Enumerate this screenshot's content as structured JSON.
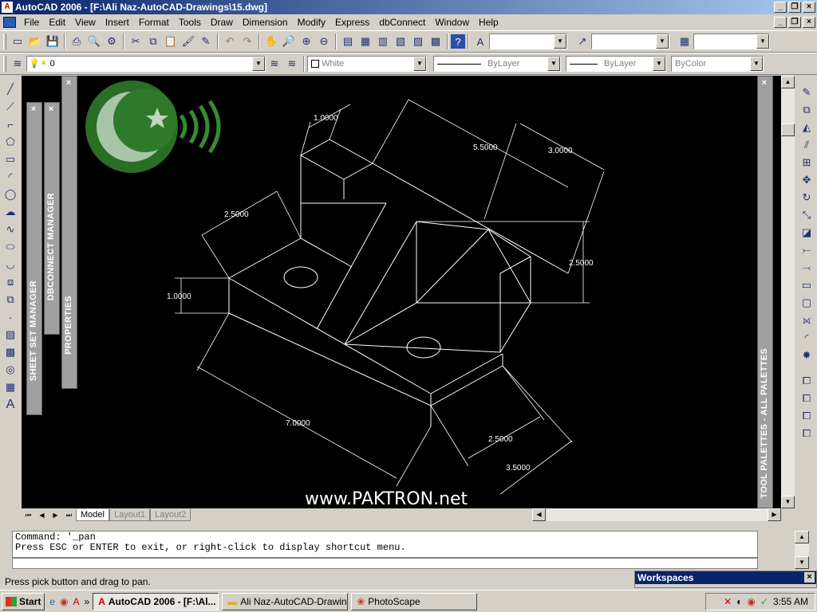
{
  "window": {
    "title": "AutoCAD 2006 - [F:\\Ali Naz-AutoCAD-Drawings\\15.dwg]",
    "app_icon": "autocad-icon"
  },
  "menu": [
    "File",
    "Edit",
    "View",
    "Insert",
    "Format",
    "Tools",
    "Draw",
    "Dimension",
    "Modify",
    "Express",
    "dbConnect",
    "Window",
    "Help"
  ],
  "properties_toolbar": {
    "layer": "0",
    "color": "White",
    "linetype": "ByLayer",
    "lineweight": "ByLayer",
    "plotstyle": "ByColor"
  },
  "palettes": {
    "sheet_set": "SHEET SET MANAGER",
    "dbconnect": "DBCONNECT MANAGER",
    "properties": "PROPERTIES",
    "tool_palettes": "TOOL PALETTES - ALL PALETTES"
  },
  "drawing": {
    "dims": [
      "1.0000",
      "5.5000",
      "3.0000",
      "2.5000",
      "2.5000",
      "1.0000",
      "7.0000",
      "2.5000",
      "3.5000"
    ],
    "watermark": "www.PAKTRON.net",
    "line_color": "#ffffff",
    "background": "#000000"
  },
  "tabs": [
    "Model",
    "Layout1",
    "Layout2"
  ],
  "command": {
    "line1": "Command: '_pan",
    "line2": "Press ESC or ENTER to exit, or right-click to display shortcut menu."
  },
  "status": "Press pick button and drag to pan.",
  "workspaces_title": "Workspaces",
  "taskbar": {
    "start": "Start",
    "tasks": [
      "AutoCAD 2006 - [F:\\Al...",
      "Ali Naz-AutoCAD-Drawings",
      "PhotoScape"
    ],
    "clock": "3:55 AM"
  }
}
